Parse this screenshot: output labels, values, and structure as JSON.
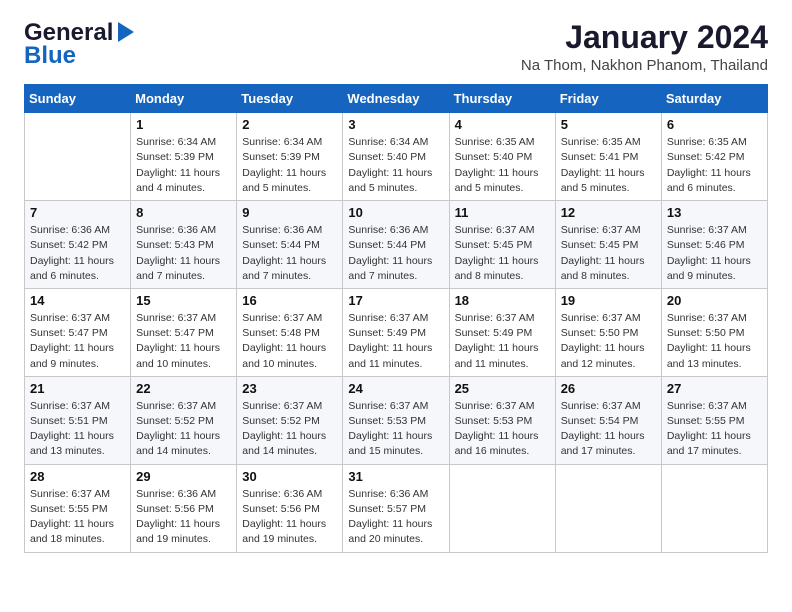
{
  "logo": {
    "line1": "General",
    "line2": "Blue"
  },
  "header": {
    "title": "January 2024",
    "subtitle": "Na Thom, Nakhon Phanom, Thailand"
  },
  "weekdays": [
    "Sunday",
    "Monday",
    "Tuesday",
    "Wednesday",
    "Thursday",
    "Friday",
    "Saturday"
  ],
  "weeks": [
    [
      {
        "day": "",
        "sunrise": "",
        "sunset": "",
        "daylight": ""
      },
      {
        "day": "1",
        "sunrise": "Sunrise: 6:34 AM",
        "sunset": "Sunset: 5:39 PM",
        "daylight": "Daylight: 11 hours and 4 minutes."
      },
      {
        "day": "2",
        "sunrise": "Sunrise: 6:34 AM",
        "sunset": "Sunset: 5:39 PM",
        "daylight": "Daylight: 11 hours and 5 minutes."
      },
      {
        "day": "3",
        "sunrise": "Sunrise: 6:34 AM",
        "sunset": "Sunset: 5:40 PM",
        "daylight": "Daylight: 11 hours and 5 minutes."
      },
      {
        "day": "4",
        "sunrise": "Sunrise: 6:35 AM",
        "sunset": "Sunset: 5:40 PM",
        "daylight": "Daylight: 11 hours and 5 minutes."
      },
      {
        "day": "5",
        "sunrise": "Sunrise: 6:35 AM",
        "sunset": "Sunset: 5:41 PM",
        "daylight": "Daylight: 11 hours and 5 minutes."
      },
      {
        "day": "6",
        "sunrise": "Sunrise: 6:35 AM",
        "sunset": "Sunset: 5:42 PM",
        "daylight": "Daylight: 11 hours and 6 minutes."
      }
    ],
    [
      {
        "day": "7",
        "sunrise": "Sunrise: 6:36 AM",
        "sunset": "Sunset: 5:42 PM",
        "daylight": "Daylight: 11 hours and 6 minutes."
      },
      {
        "day": "8",
        "sunrise": "Sunrise: 6:36 AM",
        "sunset": "Sunset: 5:43 PM",
        "daylight": "Daylight: 11 hours and 7 minutes."
      },
      {
        "day": "9",
        "sunrise": "Sunrise: 6:36 AM",
        "sunset": "Sunset: 5:44 PM",
        "daylight": "Daylight: 11 hours and 7 minutes."
      },
      {
        "day": "10",
        "sunrise": "Sunrise: 6:36 AM",
        "sunset": "Sunset: 5:44 PM",
        "daylight": "Daylight: 11 hours and 7 minutes."
      },
      {
        "day": "11",
        "sunrise": "Sunrise: 6:37 AM",
        "sunset": "Sunset: 5:45 PM",
        "daylight": "Daylight: 11 hours and 8 minutes."
      },
      {
        "day": "12",
        "sunrise": "Sunrise: 6:37 AM",
        "sunset": "Sunset: 5:45 PM",
        "daylight": "Daylight: 11 hours and 8 minutes."
      },
      {
        "day": "13",
        "sunrise": "Sunrise: 6:37 AM",
        "sunset": "Sunset: 5:46 PM",
        "daylight": "Daylight: 11 hours and 9 minutes."
      }
    ],
    [
      {
        "day": "14",
        "sunrise": "Sunrise: 6:37 AM",
        "sunset": "Sunset: 5:47 PM",
        "daylight": "Daylight: 11 hours and 9 minutes."
      },
      {
        "day": "15",
        "sunrise": "Sunrise: 6:37 AM",
        "sunset": "Sunset: 5:47 PM",
        "daylight": "Daylight: 11 hours and 10 minutes."
      },
      {
        "day": "16",
        "sunrise": "Sunrise: 6:37 AM",
        "sunset": "Sunset: 5:48 PM",
        "daylight": "Daylight: 11 hours and 10 minutes."
      },
      {
        "day": "17",
        "sunrise": "Sunrise: 6:37 AM",
        "sunset": "Sunset: 5:49 PM",
        "daylight": "Daylight: 11 hours and 11 minutes."
      },
      {
        "day": "18",
        "sunrise": "Sunrise: 6:37 AM",
        "sunset": "Sunset: 5:49 PM",
        "daylight": "Daylight: 11 hours and 11 minutes."
      },
      {
        "day": "19",
        "sunrise": "Sunrise: 6:37 AM",
        "sunset": "Sunset: 5:50 PM",
        "daylight": "Daylight: 11 hours and 12 minutes."
      },
      {
        "day": "20",
        "sunrise": "Sunrise: 6:37 AM",
        "sunset": "Sunset: 5:50 PM",
        "daylight": "Daylight: 11 hours and 13 minutes."
      }
    ],
    [
      {
        "day": "21",
        "sunrise": "Sunrise: 6:37 AM",
        "sunset": "Sunset: 5:51 PM",
        "daylight": "Daylight: 11 hours and 13 minutes."
      },
      {
        "day": "22",
        "sunrise": "Sunrise: 6:37 AM",
        "sunset": "Sunset: 5:52 PM",
        "daylight": "Daylight: 11 hours and 14 minutes."
      },
      {
        "day": "23",
        "sunrise": "Sunrise: 6:37 AM",
        "sunset": "Sunset: 5:52 PM",
        "daylight": "Daylight: 11 hours and 14 minutes."
      },
      {
        "day": "24",
        "sunrise": "Sunrise: 6:37 AM",
        "sunset": "Sunset: 5:53 PM",
        "daylight": "Daylight: 11 hours and 15 minutes."
      },
      {
        "day": "25",
        "sunrise": "Sunrise: 6:37 AM",
        "sunset": "Sunset: 5:53 PM",
        "daylight": "Daylight: 11 hours and 16 minutes."
      },
      {
        "day": "26",
        "sunrise": "Sunrise: 6:37 AM",
        "sunset": "Sunset: 5:54 PM",
        "daylight": "Daylight: 11 hours and 17 minutes."
      },
      {
        "day": "27",
        "sunrise": "Sunrise: 6:37 AM",
        "sunset": "Sunset: 5:55 PM",
        "daylight": "Daylight: 11 hours and 17 minutes."
      }
    ],
    [
      {
        "day": "28",
        "sunrise": "Sunrise: 6:37 AM",
        "sunset": "Sunset: 5:55 PM",
        "daylight": "Daylight: 11 hours and 18 minutes."
      },
      {
        "day": "29",
        "sunrise": "Sunrise: 6:36 AM",
        "sunset": "Sunset: 5:56 PM",
        "daylight": "Daylight: 11 hours and 19 minutes."
      },
      {
        "day": "30",
        "sunrise": "Sunrise: 6:36 AM",
        "sunset": "Sunset: 5:56 PM",
        "daylight": "Daylight: 11 hours and 19 minutes."
      },
      {
        "day": "31",
        "sunrise": "Sunrise: 6:36 AM",
        "sunset": "Sunset: 5:57 PM",
        "daylight": "Daylight: 11 hours and 20 minutes."
      },
      {
        "day": "",
        "sunrise": "",
        "sunset": "",
        "daylight": ""
      },
      {
        "day": "",
        "sunrise": "",
        "sunset": "",
        "daylight": ""
      },
      {
        "day": "",
        "sunrise": "",
        "sunset": "",
        "daylight": ""
      }
    ]
  ]
}
